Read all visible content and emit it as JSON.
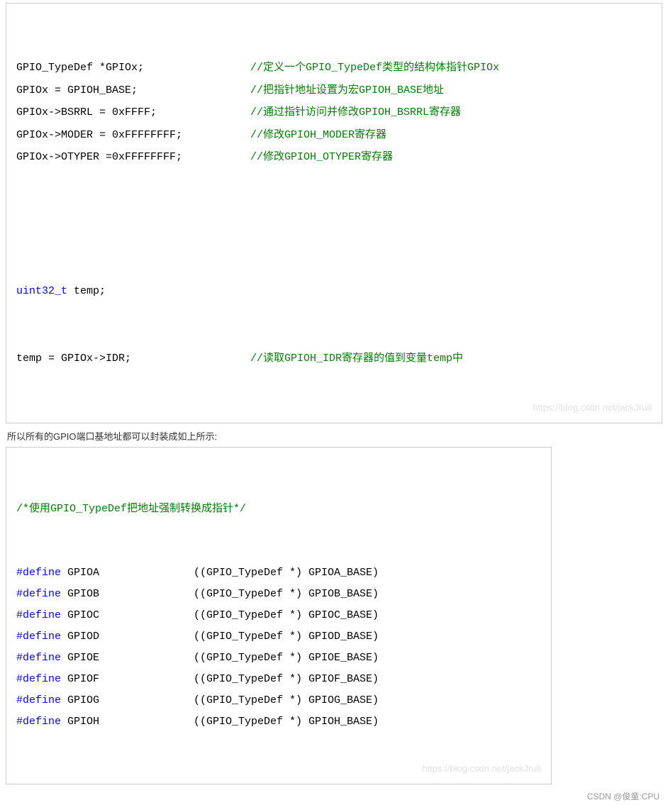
{
  "block1": {
    "lines": [
      {
        "code": "GPIO_TypeDef *GPIOx;",
        "comment": "//定义一个GPIO_TypeDef类型的结构体指针GPIOx"
      },
      {
        "code": "GPIOx = GPIOH_BASE;",
        "comment": "//把指针地址设置为宏GPIOH_BASE地址"
      },
      {
        "code": "GPIOx->BSRRL = 0xFFFF;",
        "comment": "//通过指针访问并修改GPIOH_BSRRL寄存器"
      },
      {
        "code": "GPIOx->MODER = 0xFFFFFFFF;",
        "comment": "//修改GPIOH_MODER寄存器"
      },
      {
        "code": "GPIOx->OTYPER =0xFFFFFFFF;",
        "comment": "//修改GPIOH_OTYPER寄存器"
      }
    ],
    "decl_type": "uint32_t",
    "decl_rest": " temp;",
    "last_code": "temp = GPIOx->IDR;",
    "last_comment": "//读取GPIOH_IDR寄存器的值到变量temp中",
    "watermark": "https://blog.csdn.net/jackJruit"
  },
  "caption": "所以所有的GPIO端口基地址都可以封装成如上所示:",
  "block2": {
    "comment": "/*使用GPIO_TypeDef把地址强制转换成指针*/",
    "defines": [
      {
        "name": "GPIOA",
        "base": "GPIOA_BASE"
      },
      {
        "name": "GPIOB",
        "base": "GPIOB_BASE"
      },
      {
        "name": "GPIOC",
        "base": "GPIOC_BASE"
      },
      {
        "name": "GPIOD",
        "base": "GPIOD_BASE"
      },
      {
        "name": "GPIOE",
        "base": "GPIOE_BASE"
      },
      {
        "name": "GPIOF",
        "base": "GPIOF_BASE"
      },
      {
        "name": "GPIOG",
        "base": "GPIOG_BASE"
      },
      {
        "name": "GPIOH",
        "base": "GPIOH_BASE"
      }
    ],
    "define_kw": "#define ",
    "cast_left": "((GPIO_TypeDef *) ",
    "cast_right": ")",
    "watermark": "https://blog.csdn.net/jackJruit"
  },
  "footer": "CSDN @俊童:CPU"
}
